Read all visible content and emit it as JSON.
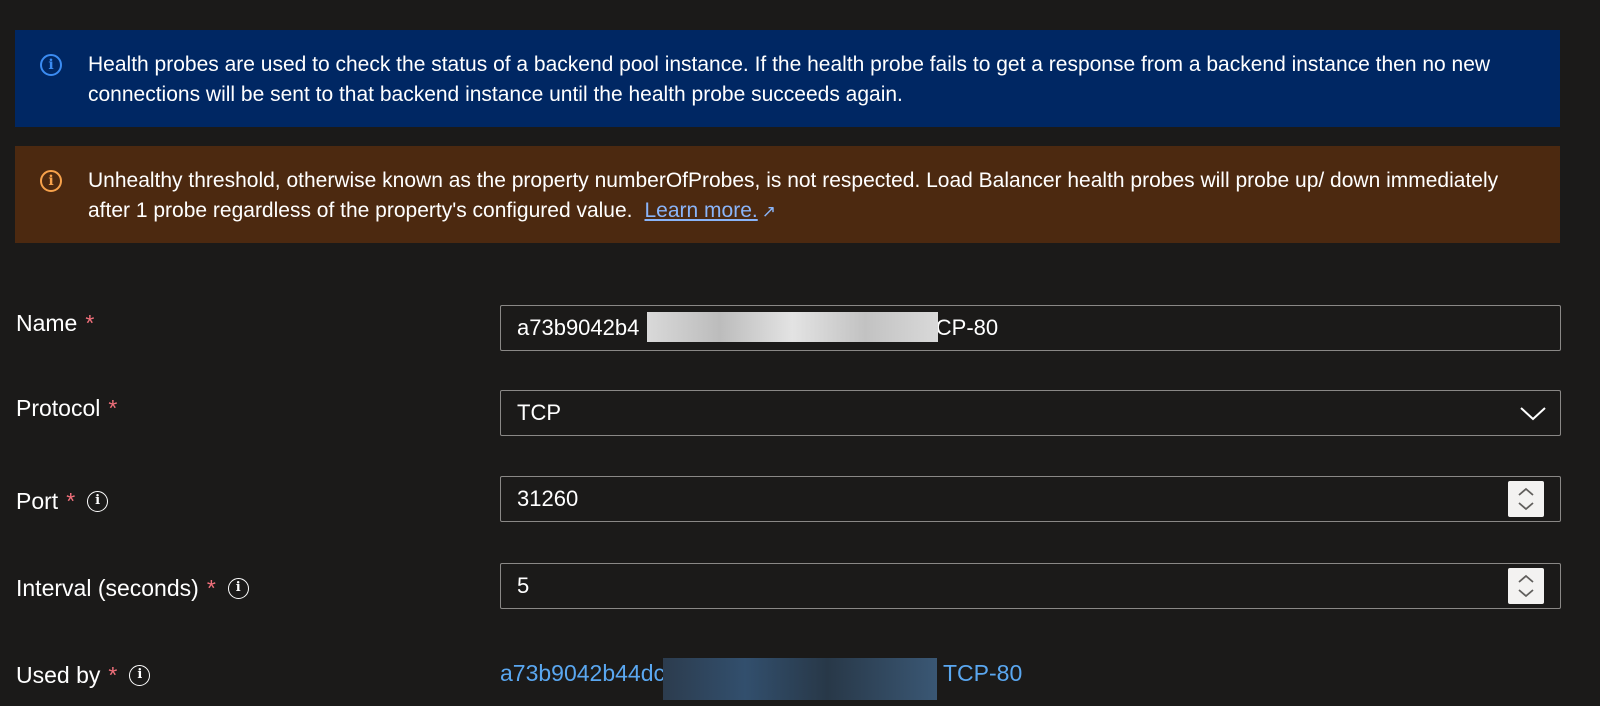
{
  "banners": {
    "info": {
      "icon": "info-icon",
      "text": "Health probes are used to check the status of a backend pool instance. If the health probe fails to get a response from a backend instance then no new connections will be sent to that backend instance until the health probe succeeds again."
    },
    "warning": {
      "icon": "warning-info-icon",
      "text": "Unhealthy threshold, otherwise known as the property numberOfProbes, is not respected. Load Balancer health probes will probe up/ down immediately after 1 probe regardless of the property's configured value.",
      "link": "Learn more.",
      "link_icon": "external-link-icon"
    }
  },
  "form": {
    "required_marker": "*",
    "name": {
      "label": "Name",
      "value_start": "a73b9042b4",
      "value_end": "TCP-80"
    },
    "protocol": {
      "label": "Protocol",
      "value": "TCP"
    },
    "port": {
      "label": "Port",
      "value": "31260"
    },
    "interval": {
      "label": "Interval (seconds)",
      "value": "5"
    },
    "used_by": {
      "label": "Used by",
      "value_start": "a73b9042b44dc",
      "value_end": "TCP-80"
    }
  },
  "colors": {
    "background": "#1b1a19",
    "info_banner": "#002763",
    "warning_banner": "#4c2910",
    "link": "#5aa7f0",
    "required": "#f1707b"
  }
}
